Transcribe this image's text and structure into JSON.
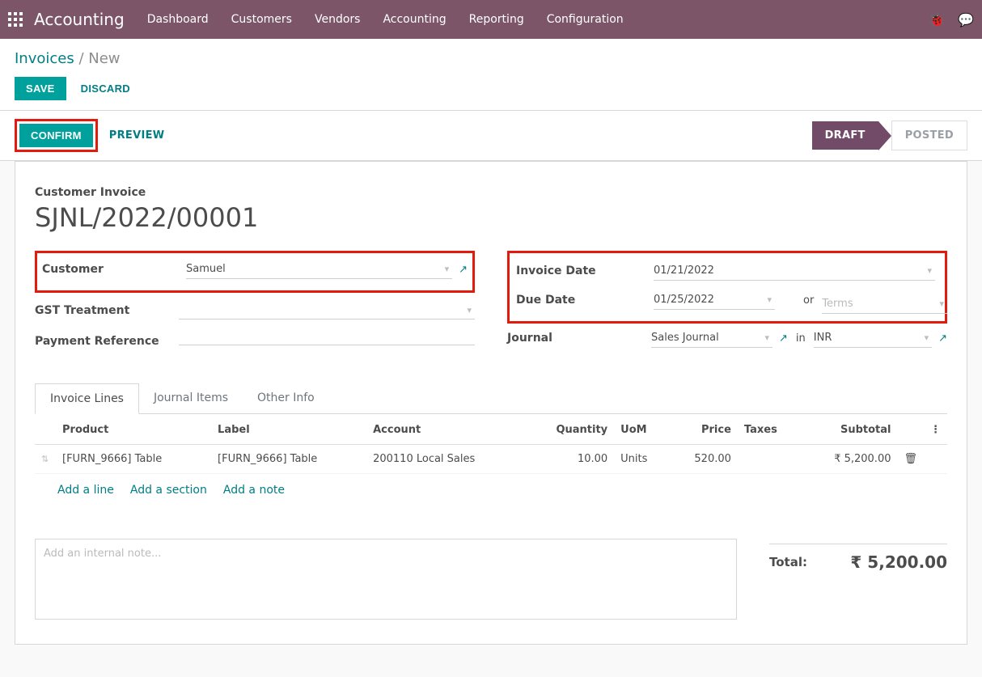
{
  "navbar": {
    "app_name": "Accounting",
    "links": [
      "Dashboard",
      "Customers",
      "Vendors",
      "Accounting",
      "Reporting",
      "Configuration"
    ]
  },
  "breadcrumb": {
    "root": "Invoices",
    "current": "New"
  },
  "cp": {
    "save": "SAVE",
    "discard": "DISCARD"
  },
  "statusbar": {
    "confirm": "CONFIRM",
    "preview": "PREVIEW",
    "draft": "DRAFT",
    "posted": "POSTED"
  },
  "sheet": {
    "title_label": "Customer Invoice",
    "name": "SJNL/2022/00001",
    "labels": {
      "customer": "Customer",
      "gst": "GST Treatment",
      "payref": "Payment Reference",
      "invdate": "Invoice Date",
      "due": "Due Date",
      "journal": "Journal",
      "or": "or",
      "in": "in"
    },
    "values": {
      "customer": "Samuel",
      "invdate": "01/21/2022",
      "due": "01/25/2022",
      "journal": "Sales Journal",
      "currency": "INR",
      "terms_placeholder": "Terms"
    }
  },
  "tabs": {
    "lines": "Invoice Lines",
    "journal": "Journal Items",
    "other": "Other Info"
  },
  "table": {
    "headers": {
      "product": "Product",
      "label": "Label",
      "account": "Account",
      "qty": "Quantity",
      "uom": "UoM",
      "price": "Price",
      "taxes": "Taxes",
      "subtotal": "Subtotal"
    },
    "rows": [
      {
        "product": "[FURN_9666] Table",
        "label": "[FURN_9666] Table",
        "account": "200110 Local Sales",
        "qty": "10.00",
        "uom": "Units",
        "price": "520.00",
        "taxes": "",
        "subtotal": "₹ 5,200.00"
      }
    ],
    "add_line": "Add a line",
    "add_section": "Add a section",
    "add_note": "Add a note"
  },
  "note_placeholder": "Add an internal note...",
  "totals": {
    "label": "Total:",
    "value": "₹ 5,200.00"
  }
}
